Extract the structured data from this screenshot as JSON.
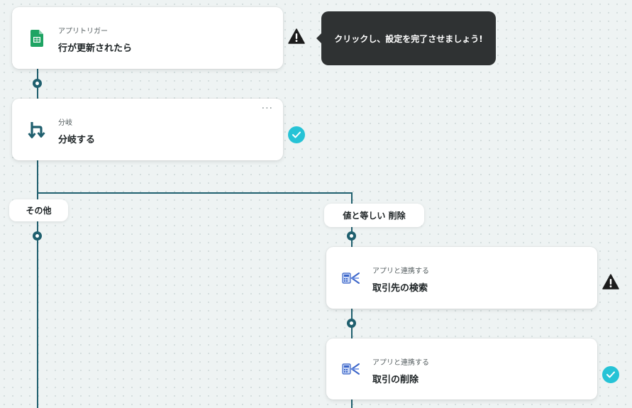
{
  "steps": {
    "trigger": {
      "sub": "アプリトリガー",
      "title": "行が更新されたら",
      "icon": "google-sheets-icon"
    },
    "branch": {
      "sub": "分岐",
      "title": "分岐する",
      "icon": "branch-icon",
      "more": "···"
    },
    "search": {
      "sub": "アプリと連携する",
      "title": "取引先の検索",
      "icon": "accounting-app-icon"
    },
    "delete": {
      "sub": "アプリと連携する",
      "title": "取引の削除",
      "icon": "accounting-app-icon"
    }
  },
  "branches": {
    "other": "その他",
    "equals": "値と等しい 削除"
  },
  "tooltip": {
    "text": "クリックし、設定を完了させましょう!"
  },
  "colors": {
    "connector": "#1f5f6e",
    "check": "#26c3d6",
    "warning": "#1c1c1c",
    "sheets_green": "#1fa463",
    "tooltip_bg": "#2f3233"
  }
}
